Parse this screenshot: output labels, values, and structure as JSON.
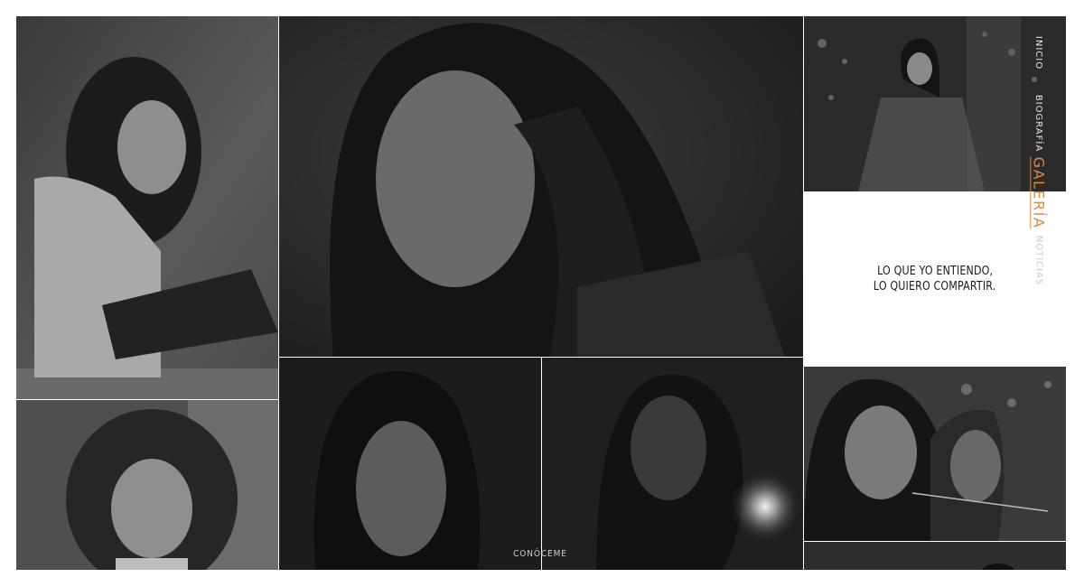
{
  "nav": {
    "items": [
      {
        "label": "INICIO",
        "active": false
      },
      {
        "label": "BIOGRAFÍA",
        "active": false
      },
      {
        "label": "GALERÍA",
        "active": true
      },
      {
        "label": "NOTICIAS",
        "active": false
      }
    ],
    "active_color": "#d88a45"
  },
  "quote": {
    "line1": "LO QUE YO ENTIENDO,",
    "line2": "LO QUIERO COMPARTIR."
  },
  "cta": {
    "label": "CONÓCEME"
  },
  "gallery": {
    "photo_count": 8,
    "style": "black-and-white portraits"
  }
}
